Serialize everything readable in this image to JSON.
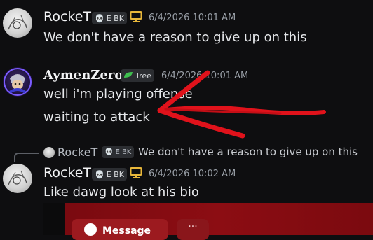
{
  "messages": [
    {
      "author": "RockeT",
      "tag": "E BK",
      "timestamp": "6/4/2026 10:01 AM",
      "lines": [
        "We don't have a reason to give up on this"
      ]
    },
    {
      "author": "AymenZero",
      "tag": "Tree",
      "timestamp": "6/4/2026 10:01 AM",
      "lines": [
        "well i'm playing offense",
        "waiting to attack"
      ]
    },
    {
      "reply_to": {
        "author": "RockeT",
        "tag": "E BK",
        "text": "We don't have a reason to give up on this"
      },
      "author": "RockeT",
      "tag": "E BK",
      "timestamp": "6/4/2026 10:02 AM",
      "lines": [
        "Like dawg look at his bio"
      ]
    }
  ],
  "embed": {
    "button_label": "Message",
    "more_label": "···"
  },
  "colors": {
    "background": "#0e0e10",
    "annotation_arrow": "#e0121b",
    "embed_banner": "#8c0d13",
    "tag_background": "#2b2d31"
  },
  "icons": {
    "tag_rocket": "skull-icon",
    "tag_aymen": "leaf-icon",
    "decoration": "monitor-icon"
  }
}
